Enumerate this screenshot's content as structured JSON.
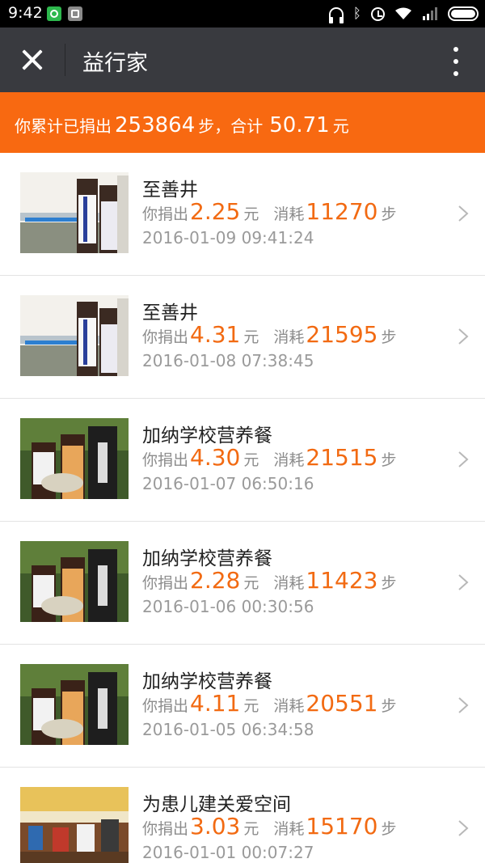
{
  "status_bar": {
    "time": "9:42"
  },
  "header": {
    "title": "益行家"
  },
  "summary": {
    "prefix": "你累计已捐出",
    "steps": "253864",
    "steps_unit": "步，合计",
    "amount": "50.71",
    "amount_unit": "元"
  },
  "labels": {
    "donated": "你捐出",
    "yuan": "元",
    "consumed": "消耗",
    "steps": "步"
  },
  "items": [
    {
      "title": "至善井",
      "amount": "2.25",
      "steps": "11270",
      "date": "2016-01-09 09:41:24",
      "image": "well"
    },
    {
      "title": "至善井",
      "amount": "4.31",
      "steps": "21595",
      "date": "2016-01-08 07:38:45",
      "image": "well"
    },
    {
      "title": "加纳学校营养餐",
      "amount": "4.30",
      "steps": "21515",
      "date": "2016-01-07 06:50:16",
      "image": "meal"
    },
    {
      "title": "加纳学校营养餐",
      "amount": "2.28",
      "steps": "11423",
      "date": "2016-01-06 00:30:56",
      "image": "meal"
    },
    {
      "title": "加纳学校营养餐",
      "amount": "4.11",
      "steps": "20551",
      "date": "2016-01-05 06:34:58",
      "image": "meal"
    },
    {
      "title": "为患儿建关爱空间",
      "amount": "3.03",
      "steps": "15170",
      "date": "2016-01-01 00:07:27",
      "image": "room"
    }
  ],
  "colors": {
    "accent": "#f86911",
    "title_bar": "#393a3f"
  }
}
